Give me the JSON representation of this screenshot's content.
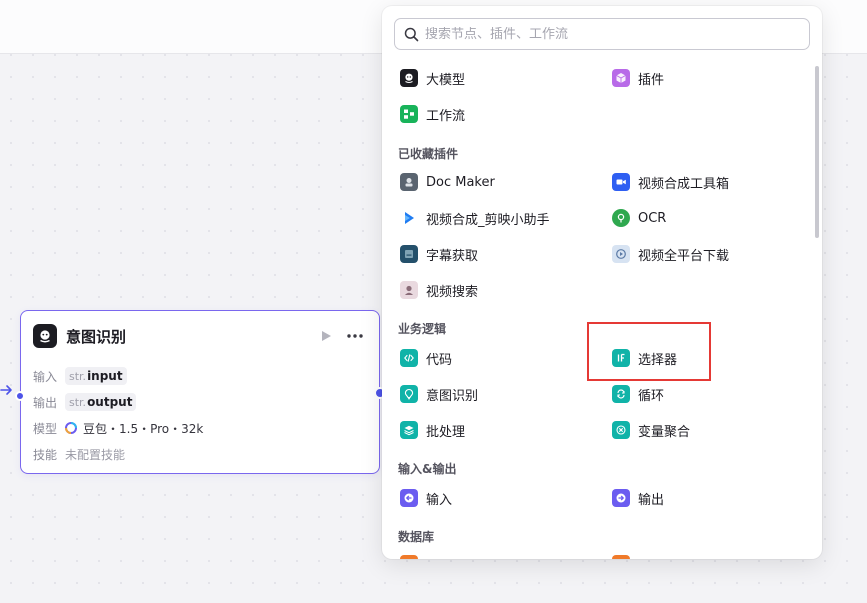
{
  "node": {
    "title": "意图识别",
    "input_label": "输入",
    "input_type": "str.",
    "input_name": "input",
    "output_label": "输出",
    "output_type": "str.",
    "output_name": "output",
    "model_label": "模型",
    "model_value": "豆包・1.5・Pro・32k",
    "skill_label": "技能",
    "skill_value": "未配置技能"
  },
  "picker": {
    "search_placeholder": "搜索节点、插件、工作流",
    "top": [
      {
        "label": "大模型",
        "icon": "llm-icon"
      },
      {
        "label": "插件",
        "icon": "plugin-cube-icon"
      },
      {
        "label": "工作流",
        "icon": "workflow-icon"
      }
    ],
    "favorites_title": "已收藏插件",
    "favorites": [
      {
        "label": "Doc Maker",
        "icon": "doc-maker-icon"
      },
      {
        "label": "视频合成工具箱",
        "icon": "video-camera-icon"
      },
      {
        "label": "视频合成_剪映小助手",
        "icon": "jianying-play-icon"
      },
      {
        "label": "OCR",
        "icon": "ocr-icon"
      },
      {
        "label": "字幕获取",
        "icon": "subtitle-icon"
      },
      {
        "label": "视频全平台下载",
        "icon": "video-download-icon"
      },
      {
        "label": "视频搜索",
        "icon": "video-search-icon"
      }
    ],
    "logic_title": "业务逻辑",
    "logic": [
      {
        "label": "代码",
        "icon": "code-icon"
      },
      {
        "label": "选择器",
        "icon": "if-selector-icon"
      },
      {
        "label": "意图识别",
        "icon": "intent-icon"
      },
      {
        "label": "循环",
        "icon": "loop-icon"
      },
      {
        "label": "批处理",
        "icon": "batch-icon"
      },
      {
        "label": "变量聚合",
        "icon": "variable-merge-icon"
      }
    ],
    "io_title": "输入&输出",
    "io": [
      {
        "label": "输入",
        "icon": "input-arrow-icon"
      },
      {
        "label": "输出",
        "icon": "output-arrow-icon"
      }
    ],
    "db_title": "数据库"
  },
  "colors": {
    "accent": "#4d53e8",
    "node_border": "#7a67ee",
    "logic_teal": "#10b3a8",
    "io_purple": "#6b5cf0",
    "db_orange": "#f07a2a",
    "highlight_red": "#e53935"
  }
}
